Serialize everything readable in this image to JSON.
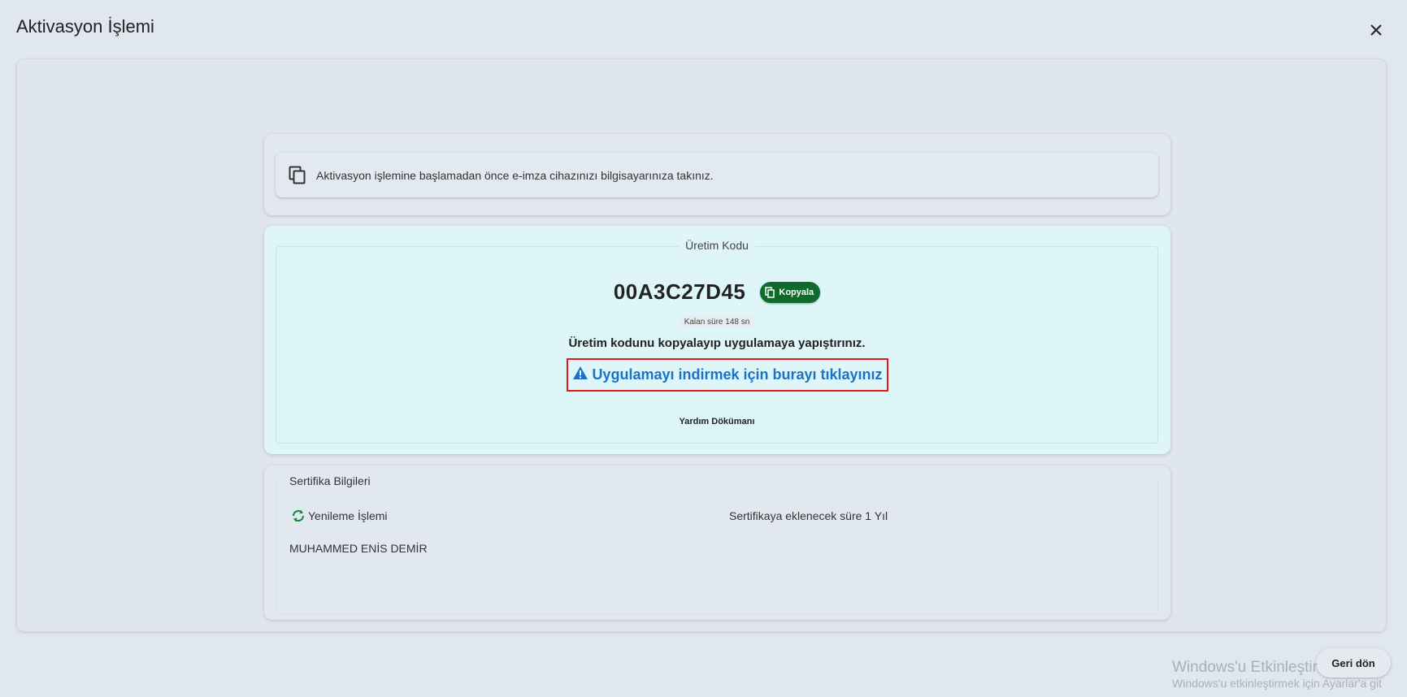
{
  "dialog": {
    "title": "Aktivasyon İşlemi",
    "close_icon": "close-icon"
  },
  "info": {
    "icon": "copy-icon",
    "text": "Aktivasyon işlemine başlamadan önce e-imza cihazınızı bilgisayarınıza takınız."
  },
  "code_card": {
    "legend": "Üretim Kodu",
    "code": "00A3C27D45",
    "copy_label": "Kopyala",
    "timer": "Kalan süre 148 sn",
    "instruction": "Üretim kodunu kopyalayıp uygulamaya yapıştırınız.",
    "download_link": "Uygulamayı indirmek için burayı tıklayınız",
    "download_icon": "warning-icon",
    "help_doc": "Yardım Dökümanı",
    "colors": {
      "copy_button": "#0f6b2c",
      "link": "#1a73c8",
      "highlight_border": "#e1191e"
    }
  },
  "cert_card": {
    "title": "Sertifika Bilgileri",
    "renewal_label": "Yenileme İşlemi",
    "renewal_icon": "refresh-icon",
    "duration": "Sertifikaya eklenecek süre 1 Yıl",
    "holder": "MUHAMMED ENİS DEMİR"
  },
  "footer": {
    "back_label": "Geri dön"
  },
  "watermark": {
    "title": "Windows'u Etkinleştir",
    "subtitle": "Windows'u etkinleştirmek için Ayarlar'a git"
  }
}
